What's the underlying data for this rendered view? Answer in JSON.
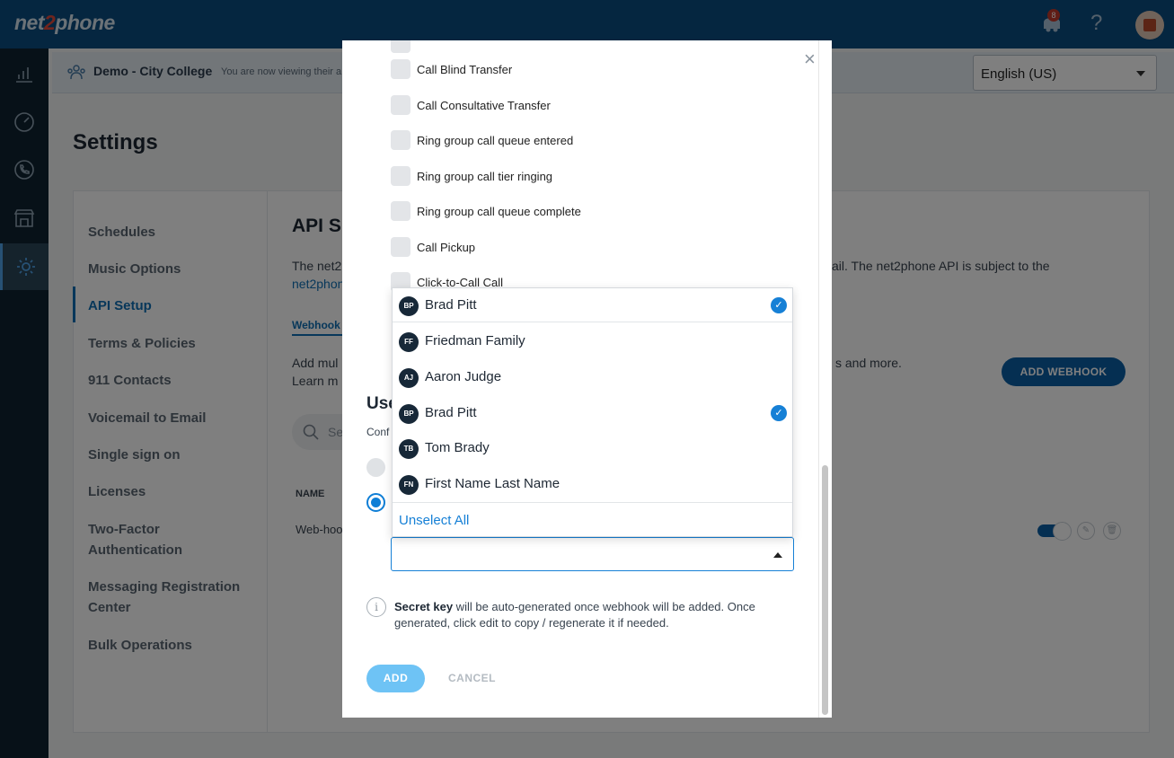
{
  "header": {
    "logo_pre": "net",
    "logo_two": "2",
    "logo_post": "phone",
    "notification_count": "8",
    "help_glyph": "?"
  },
  "banner": {
    "title": "Demo - City College",
    "subtitle": "You are now viewing their a",
    "language": "English (US)"
  },
  "page": {
    "title": "Settings"
  },
  "settings_nav": [
    {
      "label": "Schedules",
      "active": false
    },
    {
      "label": "Music Options",
      "active": false
    },
    {
      "label": "API Setup",
      "active": true
    },
    {
      "label": "Terms & Policies",
      "active": false
    },
    {
      "label": "911 Contacts",
      "active": false
    },
    {
      "label": "Voicemail to Email",
      "active": false
    },
    {
      "label": "Single sign on",
      "active": false
    },
    {
      "label": "Licenses",
      "active": false
    },
    {
      "label": "Two-Factor Authentication",
      "active": false
    },
    {
      "label": "Messaging Registration Center",
      "active": false
    },
    {
      "label": "Bulk Operations",
      "active": false
    }
  ],
  "api": {
    "title": "API S",
    "desc_start": "The net2",
    "desc_end": "ail. The net2phone API is subject to the",
    "link": "net2phon",
    "tab": "Webhook",
    "add_text_1": "Add mul",
    "add_text_2": "Learn m",
    "add_text_end": "s and more.",
    "add_webhook": "ADD WEBHOOK",
    "search_placeholder": "Se",
    "col_name": "NAME",
    "row_name": "Web-hoo"
  },
  "modal": {
    "close": "×",
    "events": [
      "Call Blind Transfer",
      "Call Consultative Transfer",
      "Ring group call queue entered",
      "Ring group call tier ringing",
      "Ring group call queue complete",
      "Call Pickup",
      "Click-to-Call Call"
    ],
    "users_title": "Use",
    "users_sub": "Conf",
    "info_bold": "Secret key",
    "info_rest": " will be auto-generated once webhook will be added. Once generated, click edit to copy / regenerate it if needed.",
    "info_glyph": "i",
    "add": "ADD",
    "cancel": "CANCEL"
  },
  "dropdown": {
    "selected_head": {
      "initials": "BP",
      "name": "Brad Pitt",
      "checked": true
    },
    "options": [
      {
        "initials": "FF",
        "name": "Friedman Family",
        "checked": false
      },
      {
        "initials": "AJ",
        "name": "Aaron Judge",
        "checked": false
      },
      {
        "initials": "BP",
        "name": "Brad Pitt",
        "checked": true
      },
      {
        "initials": "TB",
        "name": "Tom Brady",
        "checked": false
      },
      {
        "initials": "FN",
        "name": "First Name Last Name",
        "checked": false
      }
    ],
    "unselect_all": "Unselect All",
    "check_glyph": "✓"
  },
  "colors": {
    "topbar": "#0b4c80",
    "primary": "#0e6fb5",
    "accent": "#1680d6"
  }
}
